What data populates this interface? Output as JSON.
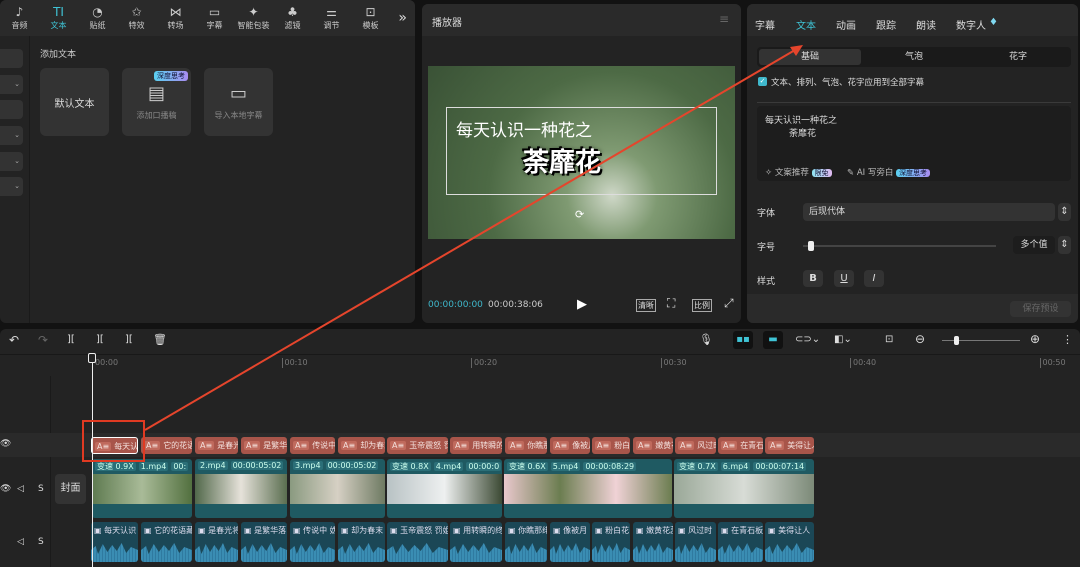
{
  "toolbar": [
    {
      "label": "音频",
      "icon": "♪"
    },
    {
      "label": "文本",
      "icon": "TI",
      "active": true
    },
    {
      "label": "贴纸",
      "icon": "◔"
    },
    {
      "label": "特效",
      "icon": "✩"
    },
    {
      "label": "转场",
      "icon": "⋈"
    },
    {
      "label": "字幕",
      "icon": "▭"
    },
    {
      "label": "智能包装",
      "icon": "✦"
    },
    {
      "label": "滤镜",
      "icon": "♣"
    },
    {
      "label": "调节",
      "icon": "⚌"
    },
    {
      "label": "模板",
      "icon": "⊡"
    }
  ],
  "more": "»",
  "left": {
    "section": "添加文本",
    "default_text": "默认文本",
    "add_script": "添加口播稿",
    "import_subs": "导入本地字幕",
    "badge": "深度思考"
  },
  "player": {
    "title": "播放器",
    "current": "00:00:00:00",
    "total": "00:00:38:06",
    "line1": "每天认识一种花之",
    "line2": "荼靡花",
    "btn_clear": "清晰",
    "btn_ratio": "比例"
  },
  "right": {
    "tabs": [
      "字幕",
      "文本",
      "动画",
      "跟踪",
      "朗读",
      "数字人"
    ],
    "subtabs": [
      "基础",
      "气泡",
      "花字"
    ],
    "apply_all": "文本、排列、气泡、花字应用到全部字幕",
    "text_line1": "每天认识一种花之",
    "text_line2": "荼靡花",
    "copy_rec": "文案推荐",
    "limited_free": "限免",
    "ai_narr": "AI 写旁白",
    "deep": "深度思考",
    "font_label": "字体",
    "font_value": "后现代体",
    "size_label": "字号",
    "size_value": "多个值",
    "style_label": "样式",
    "bold": "B",
    "underline": "U",
    "italic": "I",
    "save_preset": "保存预设"
  },
  "timeline": {
    "ticks": [
      "00:00",
      "00:10",
      "00:20",
      "00:30",
      "00:40",
      "00:50"
    ],
    "cover": "封面",
    "s": "S",
    "text_clips": [
      "每天认识",
      "它的花语藏",
      "是春光将",
      "是繁华落",
      "传说中 妫",
      "却为春末",
      "玉帝震怒 罚姐",
      "用转瞬的终",
      "你瞧那绯",
      "像被月",
      "粉白花",
      "嫩黄花蕊",
      "风过时",
      "在青石板",
      "美得让人"
    ],
    "video_clips": [
      {
        "speed": "变速 0.9X",
        "file": "1.mp4",
        "dur": "00:"
      },
      {
        "speed": "",
        "file": "2.mp4",
        "dur": "00:00:05:02"
      },
      {
        "speed": "",
        "file": "3.mp4",
        "dur": "00:00:05:02"
      },
      {
        "speed": "变速 0.8X",
        "file": "4.mp4",
        "dur": "00:00:0"
      },
      {
        "speed": "变速 0.6X",
        "file": "5.mp4",
        "dur": "00:00:08:29"
      },
      {
        "speed": "变速 0.7X",
        "file": "6.mp4",
        "dur": "00:00:07:14"
      }
    ]
  }
}
